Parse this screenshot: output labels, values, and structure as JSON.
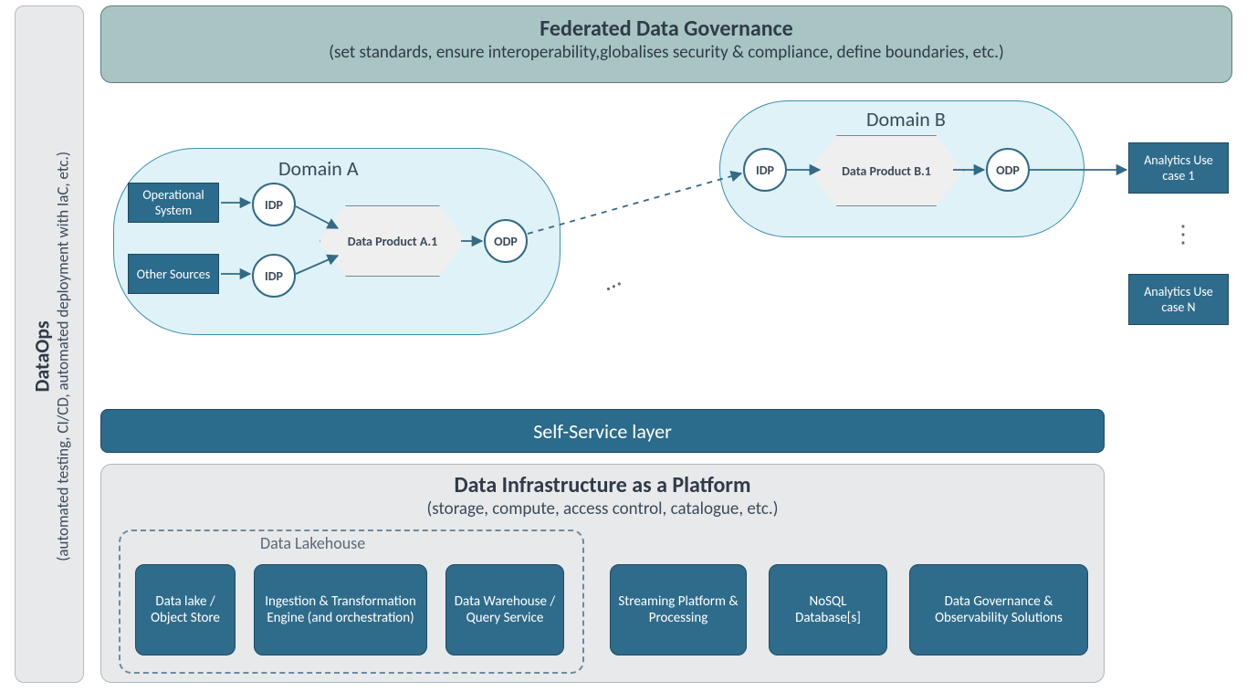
{
  "dataops": {
    "title": "DataOps",
    "subtitle": "(automated testing, CI/CD, automated deployment with IaC, etc.)"
  },
  "governance": {
    "title": "Federated Data Governance",
    "subtitle": "(set standards, ensure interoperability,globalises security & compliance, define boundaries, etc.)"
  },
  "domainA": {
    "title": "Domain A",
    "sources": {
      "operational": "Operational System",
      "other": "Other Sources"
    },
    "idp1": "IDP",
    "idp2": "IDP",
    "product": "Data Product A.1",
    "odp": "ODP"
  },
  "domainB": {
    "title": "Domain B",
    "idp": "IDP",
    "product": "Data Product B.1",
    "odp": "ODP"
  },
  "analytics": {
    "case1": "Analytics Use case 1",
    "caseN": "Analytics Use case N"
  },
  "selfservice": {
    "label": "Self-Service layer"
  },
  "infra": {
    "title": "Data Infrastructure as a Platform",
    "subtitle": "(storage, compute, access control, catalogue, etc.)",
    "lakehouse": "Data Lakehouse",
    "components": {
      "objectstore": "Data lake / Object Store",
      "ingestion": "Ingestion & Transformation Engine (and orchestration)",
      "warehouse": "Data Warehouse / Query Service",
      "streaming": "Streaming Platform & Processing",
      "nosql": "NoSQL Database[s]",
      "govobs": "Data Governance & Observability Solutions"
    }
  },
  "ellipsis": "…"
}
